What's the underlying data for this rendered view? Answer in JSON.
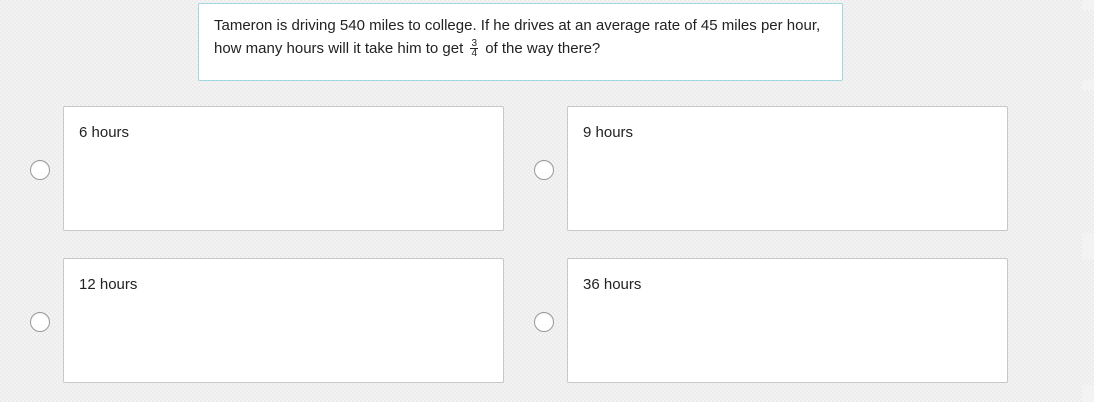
{
  "question": {
    "text_before": "Tameron is driving 540 miles to college. If he drives at an average rate of 45 miles per hour, how many hours will it take him to get",
    "fraction_numerator": "3",
    "fraction_denominator": "4",
    "text_after": "of the way there?"
  },
  "choices": [
    {
      "label": "6 hours"
    },
    {
      "label": "9 hours"
    },
    {
      "label": "12 hours"
    },
    {
      "label": "36 hours"
    }
  ],
  "colors": {
    "question_border": "#9fd8de",
    "card_border": "#c8c8c8",
    "background": "#ececec"
  }
}
